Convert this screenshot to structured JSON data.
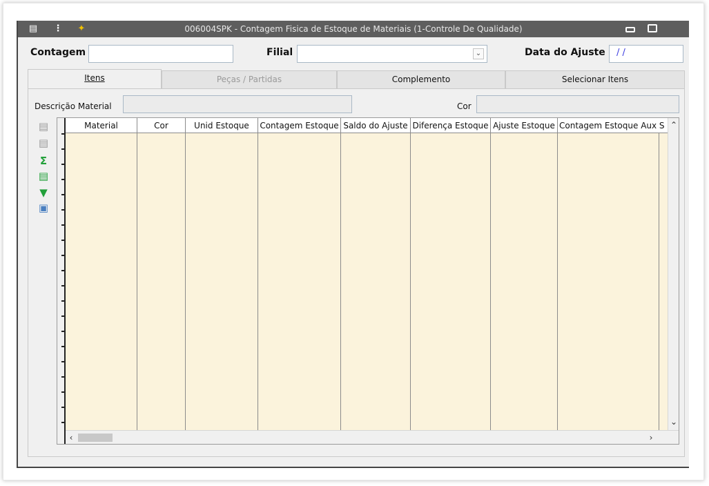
{
  "window": {
    "title": "006004SPK - Contagem Fisica de Estoque de Materiais (1-Controle De Qualidade)",
    "icons": [
      "list-icon",
      "traffic-light-icon",
      "wrench-icon"
    ]
  },
  "header": {
    "contagem_label": "Contagem",
    "contagem_value": "",
    "filial_label": "Filial",
    "filial_value": "",
    "data_label": "Data do Ajuste",
    "data_value": "/ /"
  },
  "tabs": [
    {
      "label": "Itens",
      "state": "active"
    },
    {
      "label": "Peças / Partidas",
      "state": "disabled"
    },
    {
      "label": "Complemento",
      "state": "normal"
    },
    {
      "label": "Selecionar Itens",
      "state": "normal"
    }
  ],
  "item_panel": {
    "descricao_label": "Descrição Material",
    "descricao_value": "",
    "cor_label": "Cor",
    "cor_value": ""
  },
  "toolbar_icons": [
    "add-row-icon",
    "remove-row-icon",
    "sum-icon",
    "export-icon",
    "download-icon",
    "image-icon"
  ],
  "grid": {
    "columns": [
      "Material",
      "Cor",
      "Unid Estoque",
      "Contagem Estoque",
      "Saldo do Ajuste",
      "Diferença Estoque",
      "Ajuste Estoque",
      "Contagem Estoque Aux S"
    ],
    "rows": []
  },
  "colors": {
    "titlebar": "#5e5e5e",
    "grid_background": "#fbf3dc",
    "date_text": "#3a3ae0"
  }
}
